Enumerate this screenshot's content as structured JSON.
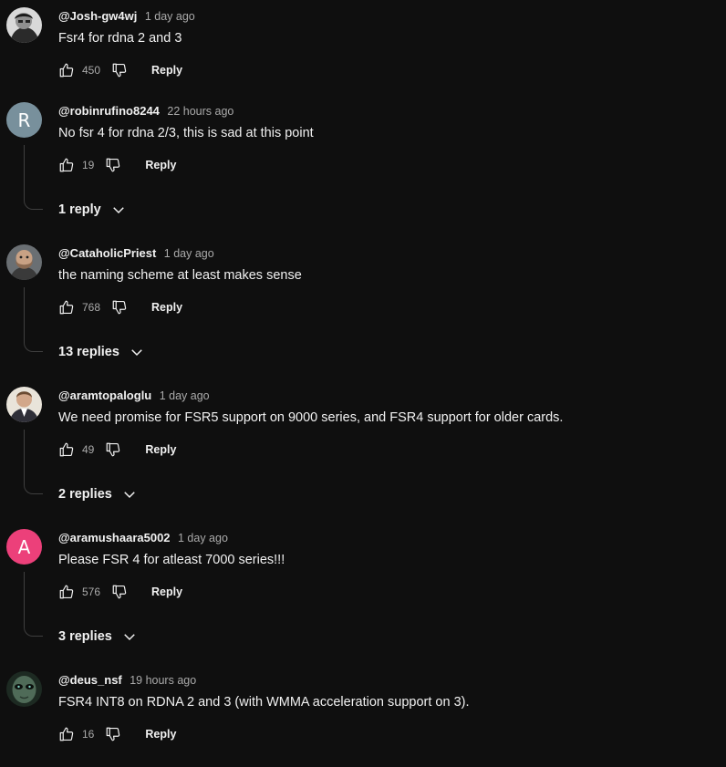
{
  "comments": [
    {
      "author": "@Josh-gw4wj",
      "time": "1 day ago",
      "text": "Fsr4 for rdna 2 and 3",
      "likes": "450",
      "reply_label": "Reply",
      "avatar": {
        "type": "photo",
        "icon": "avatar-photo-icon"
      },
      "replies": null
    },
    {
      "author": "@robinrufino8244",
      "time": "22 hours ago",
      "text": "No fsr 4 for rdna 2/3, this is sad at this point",
      "likes": "19",
      "reply_label": "Reply",
      "avatar": {
        "type": "letter",
        "letter": "R",
        "color": "#78909c"
      },
      "replies": "1 reply"
    },
    {
      "author": "@CataholicPriest",
      "time": "1 day ago",
      "text": "the naming scheme at least makes sense",
      "likes": "768",
      "reply_label": "Reply",
      "avatar": {
        "type": "photo",
        "icon": "avatar-photo-icon"
      },
      "replies": "13 replies"
    },
    {
      "author": "@aramtopaloglu",
      "time": "1 day ago",
      "text": "We need promise for FSR5 support on 9000 series, and FSR4 support for older cards.",
      "likes": "49",
      "reply_label": "Reply",
      "avatar": {
        "type": "photo",
        "icon": "avatar-photo-icon"
      },
      "replies": "2 replies"
    },
    {
      "author": "@aramushaara5002",
      "time": "1 day ago",
      "text": "Please FSR 4 for atleast 7000 series!!!",
      "likes": "576",
      "reply_label": "Reply",
      "avatar": {
        "type": "letter",
        "letter": "A",
        "color": "#ec407a"
      },
      "replies": "3 replies"
    },
    {
      "author": "@deus_nsf",
      "time": "19 hours ago",
      "text": "FSR4 INT8 on RDNA 2 and 3 (with WMMA acceleration support on 3).",
      "likes": "16",
      "reply_label": "Reply",
      "avatar": {
        "type": "photo",
        "icon": "avatar-photo-icon"
      },
      "replies": null
    }
  ],
  "icons": {
    "like": "thumbs-up-icon",
    "dislike": "thumbs-down-icon",
    "expand": "chevron-down-icon"
  },
  "colors": {
    "background": "#0f0f0f",
    "text": "#f1f1f1",
    "secondary_text": "#aaaaaa",
    "thread_line": "#3f3f3f"
  }
}
